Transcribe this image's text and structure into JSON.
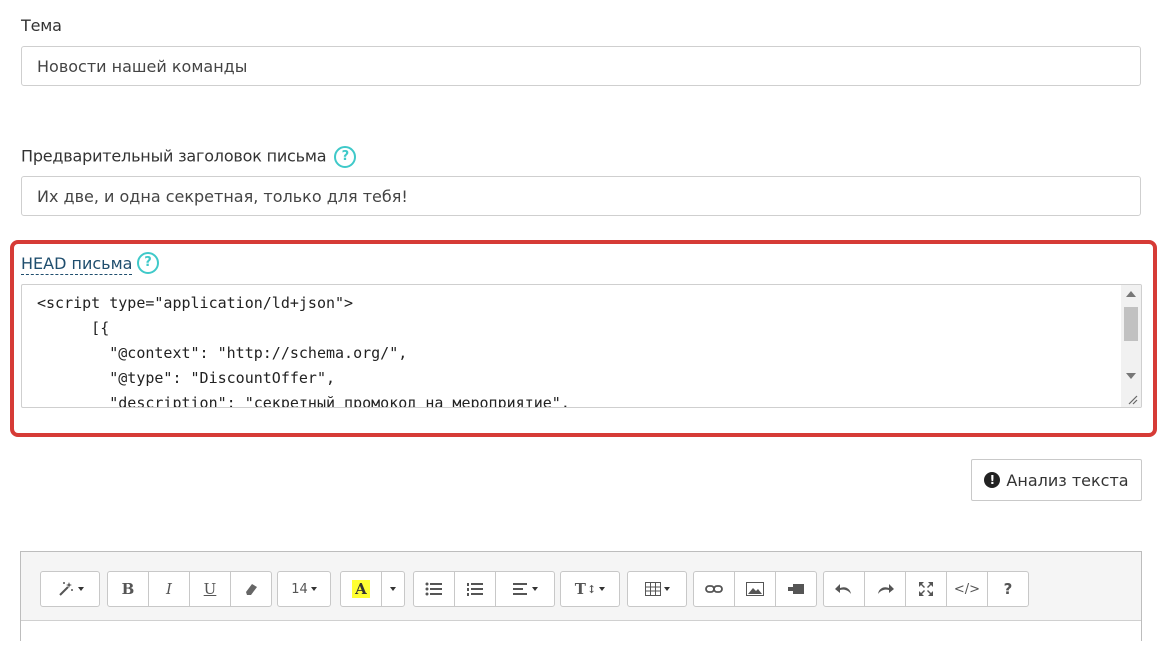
{
  "subject": {
    "label": "Тема",
    "value": "Новости нашей команды"
  },
  "preheader": {
    "label": "Предварительный заголовок письма",
    "value": "Их две, и одна секретная, только для тебя!",
    "help_icon": "?"
  },
  "head": {
    "label": "HEAD письма",
    "help_icon": "?",
    "code": "<script type=\"application/ld+json\">\n      [{\n        \"@context\": \"http://schema.org/\",\n        \"@type\": \"DiscountOffer\",\n        \"description\": \"секретный промокод на мероприятие\","
  },
  "analyze_button": {
    "label": "Анализ текста",
    "icon": "!"
  },
  "toolbar": {
    "font_size": "14",
    "bold": "B",
    "italic": "I",
    "underline": "U",
    "highlight": "A",
    "text_height": "T",
    "help": "?",
    "code_view": "</>"
  },
  "colors": {
    "highlight_frame": "#d63b36",
    "help_icon": "#3fc9c9",
    "head_label": "#1f4e6e",
    "marker": "#ffff33"
  }
}
